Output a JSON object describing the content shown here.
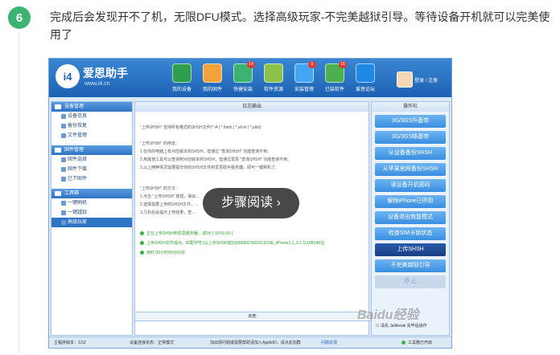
{
  "step": {
    "number": "6",
    "text": "完成后会发现开不了机，无限DFU模式。选择高级玩家-不完美越狱引导。等待设备开机就可以完美使用了"
  },
  "app": {
    "title": "爱思助手",
    "url": "www.i4.cn",
    "login": "登录 / 注册",
    "toolbar": [
      {
        "label": "我的设备",
        "icon": "phone-icon"
      },
      {
        "label": "我的固件",
        "icon": "firmware-icon"
      },
      {
        "label": "快捷安装",
        "icon": "quick-install-icon",
        "badge": "14"
      },
      {
        "label": "软件资源",
        "icon": "software-icon"
      },
      {
        "label": "安装管理",
        "icon": "install-manager-icon",
        "badge": "5"
      },
      {
        "label": "已装软件",
        "icon": "installed-icon",
        "badge": "16"
      },
      {
        "label": "爱思论坛",
        "icon": "forum-icon"
      }
    ],
    "sidebar": {
      "sections": [
        {
          "title": "设备管理",
          "items": [
            "设备信息",
            "备份恢复",
            "文件管理"
          ]
        },
        {
          "title": "固件管理",
          "items": [
            "固件选择",
            "固件下载",
            "已下固件"
          ]
        },
        {
          "title": "工具箱",
          "items": [
            "一键刷机",
            "一键越狱",
            "高级玩家"
          ]
        }
      ]
    },
    "log": {
      "title": "日志输出",
      "lines": [
        "\"上传SHSH\" 支持所有格式的SHSH文件(*.i4 | *.ifaith | *.shsh | *.plist)",
        "\"上传SHSH\" 的用途：",
        "1.在你的电脑上有对应版本的SHSH，但通过 \"查询SHSH\" 功能查询不到。",
        "2.用其他工具可以查询到对应版本的SHSH，但通过爱思 \"查询SHSH\" 功能查询不到。",
        "3.以上两种情况需要提交你的SHSH文件到爱思助手服务器，即可一键刷机了。",
        "\"上传SHSH\" 的方法：",
        "1.点击 \"上传SHSH\" 按钮，弹出...",
        "2.选择需要上传的SHSH文件，...",
        "3.几秒后会提示上传结果，查..."
      ],
      "ok_lines": [
        "正在上传SHSH到爱思服务器...                成功! [ 19:50:00 ]",
        "上传SHSH文件成功，匹配字符 [以上传SHSH成功{000002 B016C0C0E_iPhone3,1_5.1.1(10B146)}]",
        "用时 00小时00分01秒"
      ]
    },
    "progress_label": "进度:",
    "ops": {
      "title": "操作栏",
      "buttons": [
        "3G/3GS升基带",
        "3G/3GS降基带",
        "从设备备份SHSH",
        "从苹果官网备份SHSH",
        "读设备开机密码",
        "解除iPhone已停用",
        "设备退出恢复模式",
        "检查SIM卡锁状态",
        "上传SHSH",
        "不完美越狱引导",
        "停 止"
      ],
      "selected_index": 8,
      "disabled_index": 10,
      "checkbox_label": "请先 Jailbreak 完毕后操作"
    },
    "status": {
      "version": "主程序版本：3.52",
      "connection": "设备连接状态：正常模式",
      "qq_group": "加出现问题或需要帮助请加入AppleID，请点此加群",
      "feedback": "问题反馈",
      "toolbox": "工具箱已开启"
    }
  },
  "overlay": {
    "label": "步骤阅读",
    "arrow": "›"
  },
  "watermark": "Baidu经验"
}
